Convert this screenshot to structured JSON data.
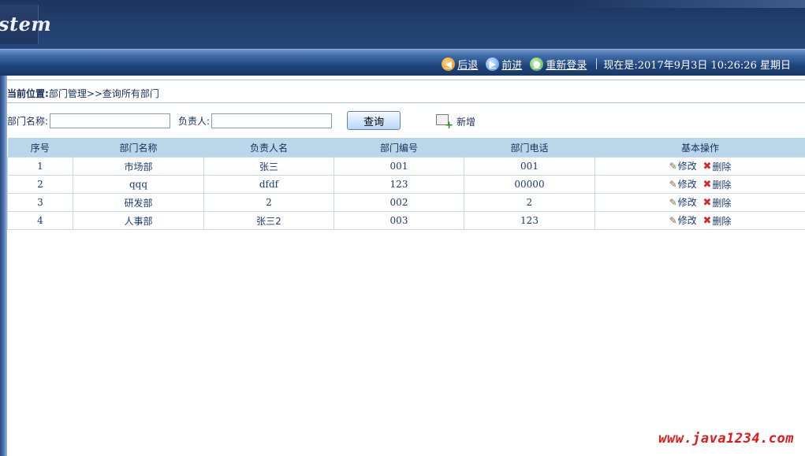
{
  "header": {
    "logo_text": "stem"
  },
  "toolbar": {
    "back_label": "后退",
    "forward_label": "前进",
    "relogin_label": "重新登录",
    "datetime": "现在是:2017年9月3日  10:26:26 星期日",
    "icons": {
      "back": "back-arrow-icon",
      "forward": "forward-arrow-icon",
      "relogin": "relogin-icon"
    }
  },
  "breadcrumb": {
    "prefix": "当前位置:",
    "path": "部门管理>>查询所有部门"
  },
  "search": {
    "dept_name_label": "部门名称:",
    "dept_name_value": "",
    "person_label": "负责人:",
    "person_value": "",
    "query_button": "查询",
    "add_label": "新增"
  },
  "table": {
    "headers": [
      "序号",
      "部门名称",
      "负责人名",
      "部门编号",
      "部门电话",
      "基本操作"
    ],
    "rows": [
      {
        "index": "1",
        "name": "市场部",
        "person": "张三",
        "code": "001",
        "phone": "001"
      },
      {
        "index": "2",
        "name": "qqq",
        "person": "dfdf",
        "code": "123",
        "phone": "00000"
      },
      {
        "index": "3",
        "name": "研发部",
        "person": "2",
        "code": "002",
        "phone": "2"
      },
      {
        "index": "4",
        "name": "人事部",
        "person": "张三2",
        "code": "003",
        "phone": "123"
      }
    ],
    "edit_label": "修改",
    "delete_label": "删除"
  },
  "watermark": "www.java1234.com",
  "colors": {
    "header_bg": "#1f3a66",
    "table_header_bg": "#b9d6eb",
    "text": "#1a2f5a",
    "watermark": "#e01a1a"
  }
}
